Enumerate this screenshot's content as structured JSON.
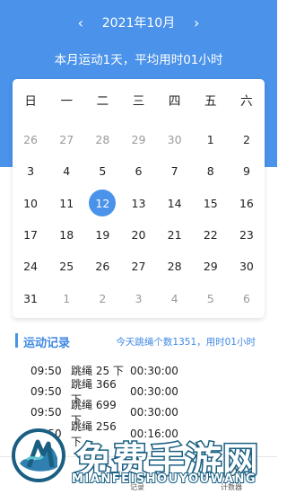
{
  "header": {
    "prev_arrow": "‹",
    "next_arrow": "›",
    "month": "2021年10月",
    "summary": "本月运动1天，平均用时01小时"
  },
  "calendar": {
    "weekdays": [
      "日",
      "一",
      "二",
      "三",
      "四",
      "五",
      "六"
    ],
    "days": [
      {
        "d": "26",
        "other": true
      },
      {
        "d": "27",
        "other": true
      },
      {
        "d": "28",
        "other": true
      },
      {
        "d": "29",
        "other": true
      },
      {
        "d": "30",
        "other": true
      },
      {
        "d": "1"
      },
      {
        "d": "2"
      },
      {
        "d": "3"
      },
      {
        "d": "4"
      },
      {
        "d": "5"
      },
      {
        "d": "6"
      },
      {
        "d": "7"
      },
      {
        "d": "8"
      },
      {
        "d": "9"
      },
      {
        "d": "10"
      },
      {
        "d": "11"
      },
      {
        "d": "12",
        "selected": true
      },
      {
        "d": "13"
      },
      {
        "d": "14"
      },
      {
        "d": "15"
      },
      {
        "d": "16"
      },
      {
        "d": "17"
      },
      {
        "d": "18"
      },
      {
        "d": "19"
      },
      {
        "d": "20"
      },
      {
        "d": "21"
      },
      {
        "d": "22"
      },
      {
        "d": "23"
      },
      {
        "d": "24"
      },
      {
        "d": "25"
      },
      {
        "d": "26"
      },
      {
        "d": "27"
      },
      {
        "d": "28"
      },
      {
        "d": "29"
      },
      {
        "d": "30"
      },
      {
        "d": "31"
      },
      {
        "d": "1",
        "other": true
      },
      {
        "d": "2",
        "other": true
      },
      {
        "d": "3",
        "other": true
      },
      {
        "d": "4",
        "other": true
      },
      {
        "d": "5",
        "other": true
      },
      {
        "d": "6",
        "other": true
      }
    ]
  },
  "records": {
    "title": "运动记录",
    "summary": "今天跳绳个数1351，用时01小时",
    "items": [
      {
        "time": "09:50",
        "activity": "跳绳 25 下",
        "duration": "00:30:00"
      },
      {
        "time": "09:50",
        "activity": "跳绳 366 下",
        "duration": "00:30:00"
      },
      {
        "time": "09:50",
        "activity": "跳绳 699 下",
        "duration": "00:30:00"
      },
      {
        "time": "09:50",
        "activity": "跳绳 256 下",
        "duration": "00:16:00"
      }
    ]
  },
  "bottom_nav": {
    "record": {
      "label": "记录",
      "icon": "pencil-icon"
    },
    "counter": {
      "label": "计数器",
      "icon": "stopwatch-icon"
    }
  },
  "watermark": {
    "title": "免费手游网",
    "subtitle": "MIANFEISHOUYOUWANG"
  },
  "colors": {
    "accent": "#4a92ea",
    "watermark_stroke": "#1a5f82"
  }
}
